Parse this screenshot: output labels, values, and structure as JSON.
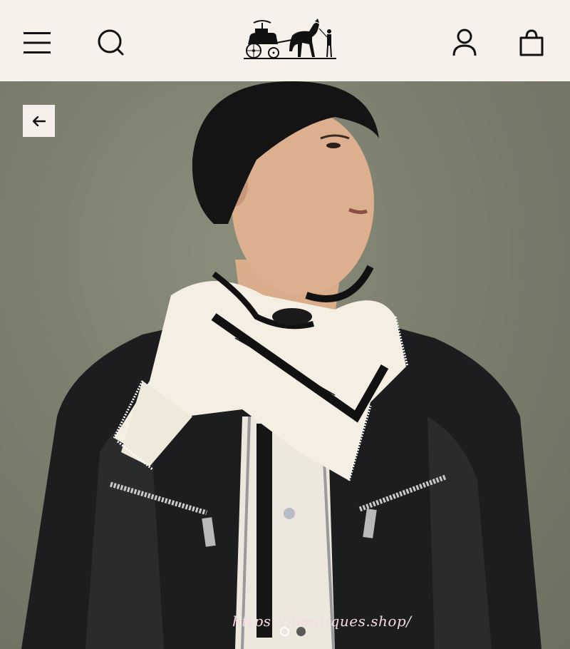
{
  "header": {
    "menu_icon": "hamburger-menu-icon",
    "search_icon": "search-icon",
    "logo_icon": "carriage-logo-icon",
    "account_icon": "user-account-icon",
    "bag_icon": "shopping-bag-icon"
  },
  "gallery": {
    "back_icon": "arrow-left-icon",
    "image_subject": "scarf-product-photo",
    "watermark": "https://jboutiques.shop/",
    "slides_total": 2,
    "active_slide": 1
  },
  "colors": {
    "header_bg": "#f6f1ea",
    "backdrop": "#7c7f6e",
    "icon": "#111111",
    "watermark": "#f4d9e3"
  }
}
